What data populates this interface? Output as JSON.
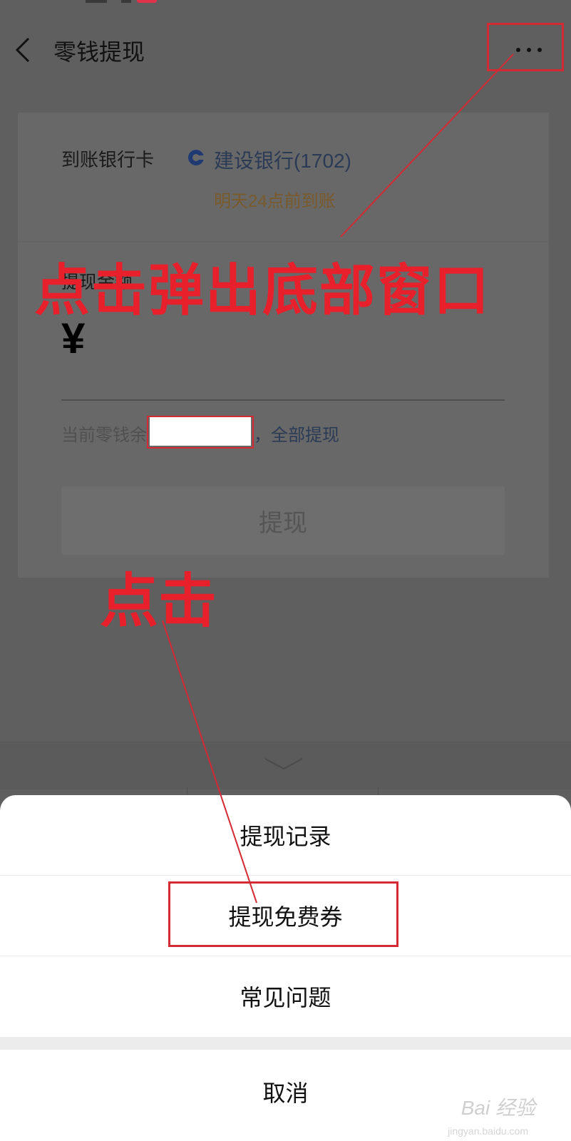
{
  "header": {
    "title": "零钱提现"
  },
  "card": {
    "bank_label": "到账银行卡",
    "bank_name": "建设银行(1702)",
    "arrival_time": "明天24点前到账",
    "amount_label": "提现金额",
    "currency_symbol": "¥",
    "balance_prefix": "当前零钱余",
    "withdraw_all": "，全部提现",
    "withdraw_button": "提现"
  },
  "sheet": {
    "items": [
      "提现记录",
      "提现免费券",
      "常见问题"
    ],
    "cancel": "取消"
  },
  "annotations": {
    "top_note": "点击弹出底部窗口",
    "middle_note": "点击"
  },
  "watermark": {
    "main": "Bai 经验",
    "sub": "jingyan.baidu.com"
  },
  "colors": {
    "annotation": "#e8202c",
    "link": "#2b3a55",
    "arrival": "#7a5a2a"
  }
}
